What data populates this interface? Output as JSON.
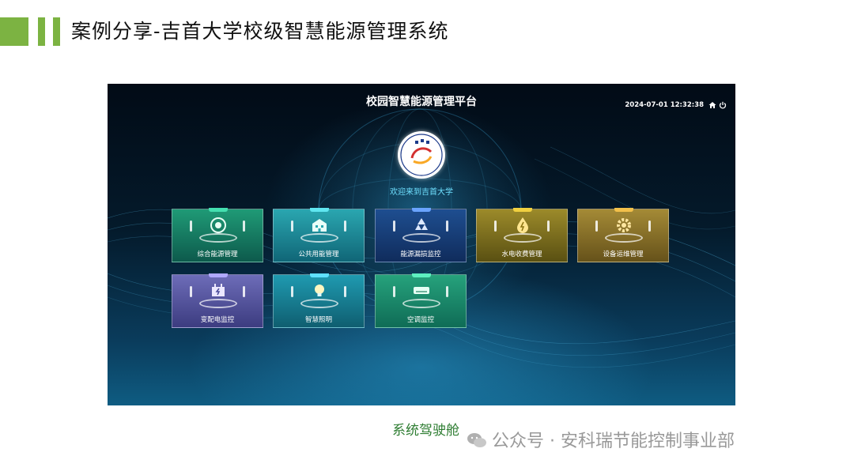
{
  "slide": {
    "title": "案例分享-吉首大学校级智慧能源管理系统",
    "caption": "系统驾驶舱",
    "watermark": "公众号 · 安科瑞节能控制事业部",
    "accent_color": "#7cb342"
  },
  "app": {
    "title": "校园智慧能源管理平台",
    "datetime": "2024-07-01 12:32:38",
    "welcome": "欢迎来到吉首大学",
    "header_icons": [
      "home-icon",
      "power-icon"
    ]
  },
  "modules": [
    {
      "label": "综合能源管理",
      "icon": "target-icon",
      "color": "#1f9a76"
    },
    {
      "label": "公共用能管理",
      "icon": "building-icon",
      "color": "#2aa6b0"
    },
    {
      "label": "能源漏损监控",
      "icon": "recycle-icon",
      "color": "#1e4e90"
    },
    {
      "label": "水电收费管理",
      "icon": "drop-icon",
      "color": "#9c8a2a"
    },
    {
      "label": "设备运维管理",
      "icon": "gear-icon",
      "color": "#a48a36"
    },
    {
      "label": "变配电监控",
      "icon": "power-supply-icon",
      "color": "#6d6cb8"
    },
    {
      "label": "智慧照明",
      "icon": "bulb-icon",
      "color": "#1f9ab0"
    },
    {
      "label": "空调监控",
      "icon": "air-conditioner-icon",
      "color": "#26a27c"
    }
  ]
}
